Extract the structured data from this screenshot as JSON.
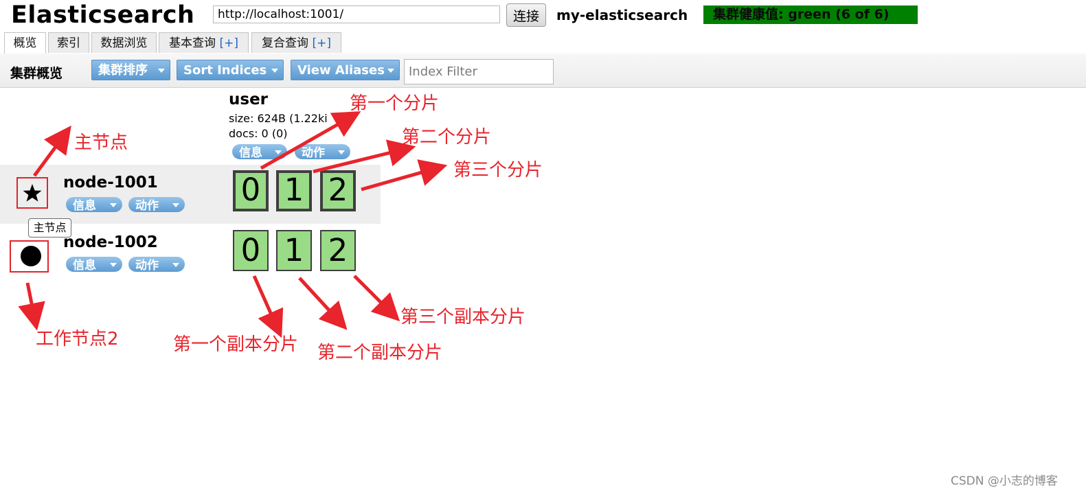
{
  "header": {
    "app_title": "Elasticsearch",
    "url_value": "http://localhost:1001/",
    "connect_label": "连接",
    "cluster_name": "my-elasticsearch",
    "health_label": "集群健康值: green (6 of 6)",
    "health_color": "#008000"
  },
  "tabs": [
    {
      "label": "概览",
      "plus": ""
    },
    {
      "label": "索引",
      "plus": ""
    },
    {
      "label": "数据浏览",
      "plus": ""
    },
    {
      "label": "基本查询",
      "plus": "[+]"
    },
    {
      "label": "复合查询",
      "plus": "[+]"
    }
  ],
  "toolbar": {
    "title": "集群概览",
    "buttons": [
      "集群排序",
      "Sort Indices",
      "View Aliases"
    ],
    "filter_placeholder": "Index Filter"
  },
  "index": {
    "name": "user",
    "size": "size: 624B (1.22ki",
    "docs": "docs: 0 (0)",
    "info_label": "信息",
    "action_label": "动作"
  },
  "nodes": [
    {
      "name": "node-1001",
      "icon": "star-icon",
      "info_label": "信息",
      "action_label": "动作",
      "shards": [
        "0",
        "1",
        "2"
      ]
    },
    {
      "name": "node-1002",
      "icon": "circle-icon",
      "info_label": "信息",
      "action_label": "动作",
      "shards": [
        "0",
        "1",
        "2"
      ]
    }
  ],
  "tooltip": "主节点",
  "annotations": {
    "master_node": "主节点",
    "worker_node": "工作节点2",
    "shard_1": "第一个分片",
    "shard_2": "第二个分片",
    "shard_3": "第三个分片",
    "replica_1": "第一个副本分片",
    "replica_2": "第二个副本分片",
    "replica_3": "第三个副本分片",
    "color": "#e8242c"
  },
  "watermark": "CSDN @小志的博客"
}
